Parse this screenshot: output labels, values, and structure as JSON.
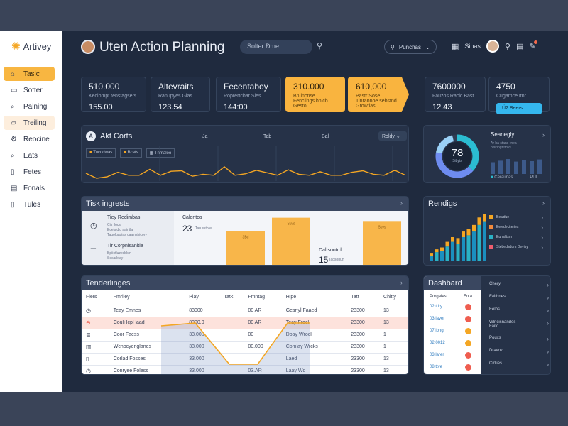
{
  "sidebar": {
    "brand": "Artivey",
    "items": [
      {
        "label": "Taslc",
        "icon": "home-icon",
        "state": "active"
      },
      {
        "label": "Sotter",
        "icon": "monitor-icon",
        "state": ""
      },
      {
        "label": "Palning",
        "icon": "search-doc-icon",
        "state": ""
      },
      {
        "label": "Treiling",
        "icon": "folder-icon",
        "state": "soft"
      },
      {
        "label": "Reocine",
        "icon": "gear-icon",
        "state": ""
      },
      {
        "label": "Eats",
        "icon": "search-icon",
        "state": ""
      },
      {
        "label": "Fetes",
        "icon": "document-icon",
        "state": ""
      },
      {
        "label": "Fonals",
        "icon": "clipboard-icon",
        "state": ""
      },
      {
        "label": "Tules",
        "icon": "file-icon",
        "state": ""
      }
    ]
  },
  "header": {
    "title": "Uten Action Planning",
    "search_placeholder": "Solter Ðme",
    "filter_label": "Punchas",
    "user_label": "Sinas"
  },
  "kpis": [
    {
      "value": "510.000",
      "sub": "Keclompt tenstagsers",
      "num": "155.00",
      "style": "dark"
    },
    {
      "value": "Altevraits",
      "sub": "Ranupyes Gias",
      "num": "123.54",
      "style": "dark"
    },
    {
      "value": "Fecentaboy",
      "sub": "Roprertcbar Sies",
      "num": "144:00",
      "style": "dark"
    },
    {
      "value": "310.000",
      "sub": "Bn lncnse\nFenclings bnicb\nGesto",
      "num": "",
      "style": "orange"
    },
    {
      "value": "610,000",
      "sub": "Pastr Sose\nTinrannoe sebstnd\nGrowtias",
      "num": "",
      "style": "orange-arrow"
    },
    {
      "value": "7600000",
      "sub": "Fauzos Racic Bast",
      "num": "12.43",
      "style": "dark"
    },
    {
      "value": "4750",
      "sub": "Cugamce Itnr",
      "num": "",
      "cta": "Ü2 Beers",
      "style": "dark-cta"
    }
  ],
  "aktcorts": {
    "title": "Akt Corts",
    "tabs": [
      "Tucodwas",
      "Bcats",
      "Tnmaloo"
    ],
    "axis": [
      "Ja",
      "Tab",
      "Bal"
    ],
    "dropdown": "Roldy",
    "series": [
      5,
      4,
      4.3,
      5.2,
      4.6,
      4.6,
      5.8,
      4.6,
      5.4,
      5.5,
      4.4,
      4.8,
      4.6,
      6.3,
      4.6,
      4.9,
      5.6,
      5.1,
      4.6,
      5.7,
      4.8,
      4.6,
      5.3,
      4.6,
      4.6,
      5.2,
      5.5,
      4.8,
      4.6,
      5.6,
      4.6
    ]
  },
  "ring": {
    "value": "78",
    "caption": "Sibyts",
    "title": "Seanegly",
    "note": "Ar ba stans rnea\nbiskingt tmvs",
    "legend": [
      "Ceraunas",
      "Pl ll"
    ],
    "bars": [
      0.55,
      0.62,
      0.7,
      0.58,
      0.66,
      0.6,
      0.68
    ]
  },
  "task": {
    "title": "Tisk ingrests",
    "items": [
      {
        "title": "Tiey Redimbas",
        "line1": "Cis tlocs",
        "line2": "Ecelsidlu aaintla",
        "line3": "Tauolgapias caainshicory",
        "icon": "clock-icon"
      },
      {
        "title": "Tir Corpnisanitie",
        "line1": "Bpiiotluzesbkrn",
        "line2": "Sesarktay",
        "line3": "",
        "icon": "book-icon"
      }
    ],
    "stat1": {
      "label": "Calontos",
      "value": "23",
      "sub": "Tau sstore"
    },
    "stat2": {
      "label": "Daltsontrd",
      "value": "15",
      "sub": "Tagsopun"
    },
    "bars": [
      {
        "label": "3Bd",
        "value": 0.38
      },
      {
        "label": "Suvs",
        "value": 0.62
      },
      {
        "label": "Suvs",
        "value": 0.56
      }
    ]
  },
  "rendings": {
    "title": "Rendigs",
    "legend": [
      {
        "label": "Bewdue",
        "color": "#f4a623"
      },
      {
        "label": "Eeledeciteries",
        "color": "#f28a3c"
      },
      {
        "label": "Eunalitsm",
        "color": "#2ab1c4"
      },
      {
        "label": "Stebedadurs Devisy",
        "color": "#ef5d6e"
      }
    ],
    "bars": [
      [
        0.1,
        0.05
      ],
      [
        0.18,
        0.06
      ],
      [
        0.2,
        0.08
      ],
      [
        0.3,
        0.1
      ],
      [
        0.4,
        0.1
      ],
      [
        0.36,
        0.12
      ],
      [
        0.5,
        0.12
      ],
      [
        0.54,
        0.14
      ],
      [
        0.62,
        0.14
      ],
      [
        0.76,
        0.16
      ],
      [
        0.84,
        0.16
      ]
    ]
  },
  "tender": {
    "title": "Tenderlinges",
    "columns": [
      "Flers",
      "Fmrlley",
      "Play",
      "Tatk",
      "Fmntag",
      "Hlpe",
      "Tatt",
      "Chitty"
    ],
    "rows": [
      [
        "",
        "Teay Emnes",
        "83000",
        "",
        "00 AR",
        "Gesnyl Faaed",
        "23300",
        "13",
        "clock-icon",
        ""
      ],
      [
        "",
        "Couli Icpl laad",
        "8390.0",
        "",
        "00 AR",
        "Teay Frocl",
        "23300",
        "13",
        "alert-icon",
        "hl"
      ],
      [
        "",
        "Coor Faess",
        "33.000",
        "",
        "00",
        "Doay Wrocl",
        "23300",
        "1",
        "list-icon",
        ""
      ],
      [
        "",
        "Wcnocyenglanes",
        "33.000",
        "",
        "00.000",
        "Comlay Wrcks",
        "23300",
        "1",
        "chart-icon",
        ""
      ],
      [
        "",
        "Corlad Fosses",
        "33.000",
        "",
        "",
        "Laed",
        "23300",
        "13",
        "doc-icon",
        ""
      ],
      [
        "",
        "Conryee Foless",
        "33.000",
        "",
        "03.AR",
        "Laay Wd",
        "23300",
        "13",
        "clock-icon",
        ""
      ]
    ]
  },
  "dashbard": {
    "title": "Dashbard",
    "columns": [
      "Porgales",
      "Fota"
    ],
    "rows": [
      "02 ttiry",
      "03 laver",
      "07 lbng",
      "02 0012",
      "03 larer",
      "08 ttve"
    ],
    "dots": [
      "#ef5d4f",
      "#ef5d4f",
      "#f4a623",
      "#f4a623",
      "#ef5d4f",
      "#ef5d4f"
    ],
    "side": [
      "Chery",
      "Falthnes",
      "Eelbs",
      "Wlncisnandes\nFaitd",
      "Pouxs",
      "Dravoz",
      "Cidlies"
    ]
  }
}
